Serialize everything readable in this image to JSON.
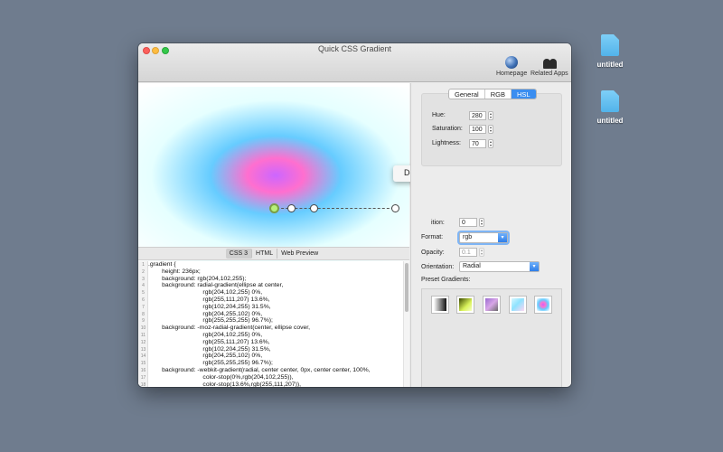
{
  "desktop": {
    "icons": [
      {
        "label": "untitled"
      },
      {
        "label": "untitled"
      }
    ]
  },
  "window": {
    "title": "Quick CSS Gradient",
    "toolbar": {
      "homepage_label": "Homepage",
      "related_label": "Related Apps"
    }
  },
  "context_menu": {
    "delete_label": "Delete"
  },
  "code_tabs": [
    {
      "label": "CSS 3"
    },
    {
      "label": "HTML"
    },
    {
      "label": "Web Preview"
    }
  ],
  "code": {
    "lines": [
      {
        "n": "1",
        "text": ".gradient {"
      },
      {
        "n": "2",
        "text": "        height: 236px;"
      },
      {
        "n": "3",
        "text": "        background: rgb(204,102,255);"
      },
      {
        "n": "4",
        "text": "        background: radial-gradient(ellipse at center,"
      },
      {
        "n": "5",
        "text": "                                rgb(204,102,255) 0%,"
      },
      {
        "n": "6",
        "text": "                                rgb(255,111,207) 13.6%,"
      },
      {
        "n": "7",
        "text": "                                rgb(102,204,255) 31.5%,"
      },
      {
        "n": "8",
        "text": "                                rgb(204,255,102) 0%,"
      },
      {
        "n": "9",
        "text": "                                rgb(255,255,255) 96.7%);"
      },
      {
        "n": "10",
        "text": "        background: -moz-radial-gradient(center, ellipse cover,"
      },
      {
        "n": "11",
        "text": "                                rgb(204,102,255) 0%,"
      },
      {
        "n": "12",
        "text": "                                rgb(255,111,207) 13.6%,"
      },
      {
        "n": "13",
        "text": "                                rgb(102,204,255) 31.5%,"
      },
      {
        "n": "14",
        "text": "                                rgb(204,255,102) 0%,"
      },
      {
        "n": "15",
        "text": "                                rgb(255,255,255) 96.7%);"
      },
      {
        "n": "16",
        "text": "        background: -webkit-gradient(radial, center center, 0px, center center, 100%,"
      },
      {
        "n": "17",
        "text": "                                color-stop(0%,rgb(204,102,255)),"
      },
      {
        "n": "18",
        "text": "                                color-stop(13.6%,rgb(255,111,207)),"
      }
    ]
  },
  "color_mode": {
    "tabs": [
      {
        "label": "General"
      },
      {
        "label": "RGB"
      },
      {
        "label": "HSL"
      }
    ]
  },
  "hsl": {
    "hue_label": "Hue:",
    "hue_value": "280",
    "saturation_label": "Saturation:",
    "saturation_value": "100",
    "lightness_label": "Lightness:",
    "lightness_value": "70"
  },
  "stop_props": {
    "position_label": "ition:",
    "position_value": "0",
    "format_label": "Format:",
    "format_value": "rgb",
    "opacity_label": "Opacity:",
    "opacity_value": "0.1",
    "orientation_label": "Orientation:",
    "orientation_value": "Radial",
    "presets_label": "Preset Gradients:"
  },
  "add_button_label": "+",
  "colors": {
    "accent": "#3b8ef0",
    "desktop": "#6f7c8e"
  }
}
